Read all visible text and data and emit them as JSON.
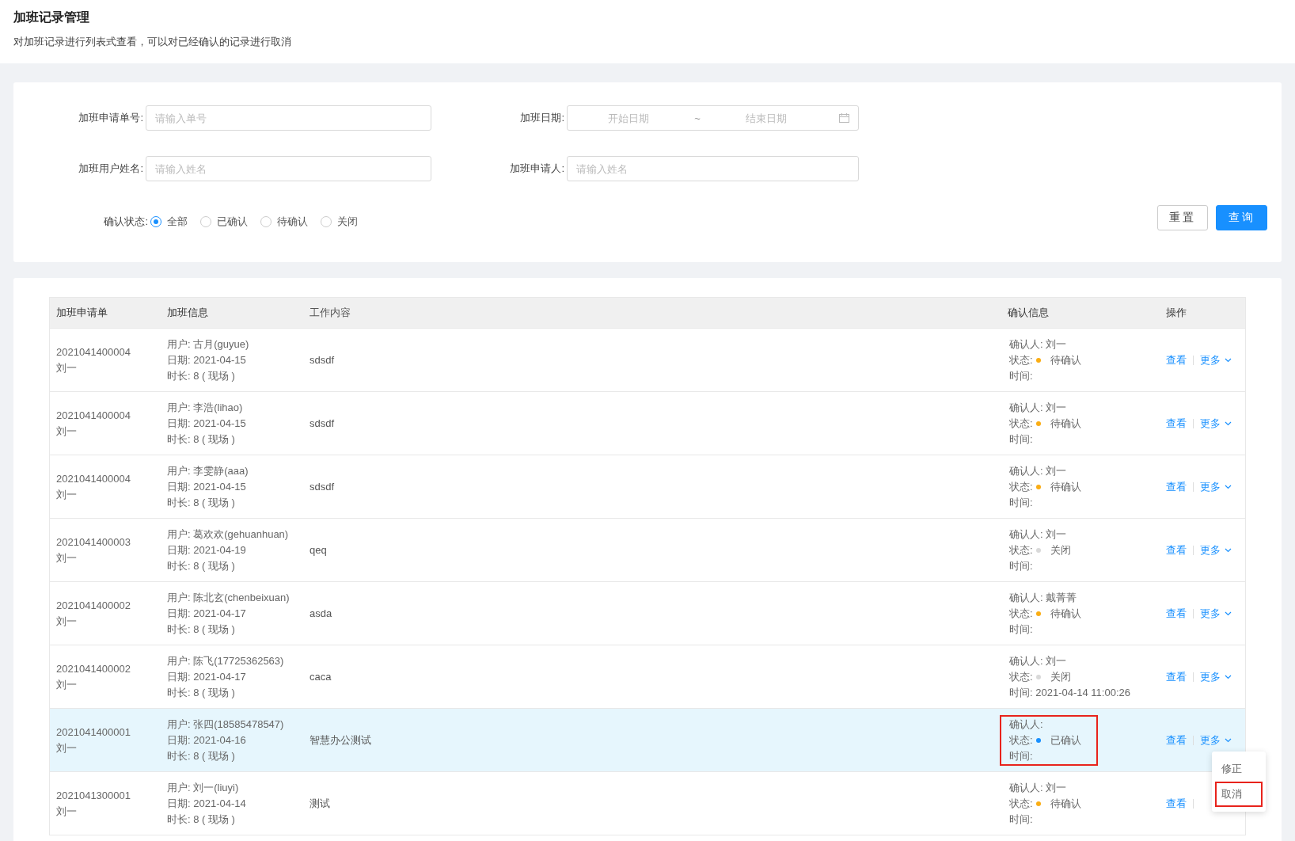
{
  "header": {
    "title": "加班记录管理",
    "subtitle": "对加班记录进行列表式查看，可以对已经确认的记录进行取消"
  },
  "filters": {
    "fields": [
      {
        "kind": "text",
        "label": "加班申请单号:",
        "placeholder": "请输入单号"
      },
      {
        "kind": "daterange",
        "label": "加班日期:",
        "start_placeholder": "开始日期",
        "separator": "~",
        "end_placeholder": "结束日期"
      },
      {
        "kind": "text",
        "label": "加班用户姓名:",
        "placeholder": "请输入姓名"
      },
      {
        "kind": "text",
        "label": "加班申请人:",
        "placeholder": "请输入姓名"
      }
    ],
    "status": {
      "label": "确认状态:",
      "options": [
        {
          "label": "全部",
          "selected": true
        },
        {
          "label": "已确认",
          "selected": false
        },
        {
          "label": "待确认",
          "selected": false
        },
        {
          "label": "关闭",
          "selected": false
        }
      ]
    },
    "buttons": [
      {
        "label": "重置",
        "kind": "default"
      },
      {
        "label": "查询",
        "kind": "primary"
      }
    ]
  },
  "table": {
    "columns": [
      "加班申请单",
      "加班信息",
      "工作内容",
      "确认信息",
      "操作"
    ],
    "rows": [
      {
        "order_no": "2021041400004",
        "applicant": "刘一",
        "user": "用户: 古月(guyue)",
        "date": "日期: 2021-04-15",
        "duration": "时长: 8 ( 现场 )",
        "content": "sdsdf",
        "confirmer": "确认人: 刘一",
        "status_label": "状态:",
        "status": "待确认",
        "color": "#faad14",
        "time": "时间:",
        "view": "查看",
        "more": "更多",
        "selected": false,
        "annotated": false
      },
      {
        "order_no": "2021041400004",
        "applicant": "刘一",
        "user": "用户: 李浩(lihao)",
        "date": "日期: 2021-04-15",
        "duration": "时长: 8 ( 现场 )",
        "content": "sdsdf",
        "confirmer": "确认人: 刘一",
        "status_label": "状态:",
        "status": "待确认",
        "color": "#faad14",
        "time": "时间:",
        "view": "查看",
        "more": "更多",
        "selected": false,
        "annotated": false
      },
      {
        "order_no": "2021041400004",
        "applicant": "刘一",
        "user": "用户: 李雯静(aaa)",
        "date": "日期: 2021-04-15",
        "duration": "时长: 8 ( 现场 )",
        "content": "sdsdf",
        "confirmer": "确认人: 刘一",
        "status_label": "状态:",
        "status": "待确认",
        "color": "#faad14",
        "time": "时间:",
        "view": "查看",
        "more": "更多",
        "selected": false,
        "annotated": false
      },
      {
        "order_no": "2021041400003",
        "applicant": "刘一",
        "user": "用户: 葛欢欢(gehuanhuan)",
        "date": "日期: 2021-04-19",
        "duration": "时长: 8 ( 现场 )",
        "content": "qeq",
        "confirmer": "确认人: 刘一",
        "status_label": "状态:",
        "status": "关闭",
        "color": "#d9d9d9",
        "time": "时间:",
        "view": "查看",
        "more": "更多",
        "selected": false,
        "annotated": false
      },
      {
        "order_no": "2021041400002",
        "applicant": "刘一",
        "user": "用户: 陈北玄(chenbeixuan)",
        "date": "日期: 2021-04-17",
        "duration": "时长: 8 ( 现场 )",
        "content": "asda",
        "confirmer": "确认人: 戴菁菁",
        "status_label": "状态:",
        "status": "待确认",
        "color": "#faad14",
        "time": "时间:",
        "view": "查看",
        "more": "更多",
        "selected": false,
        "annotated": false
      },
      {
        "order_no": "2021041400002",
        "applicant": "刘一",
        "user": "用户: 陈飞(17725362563)",
        "date": "日期: 2021-04-17",
        "duration": "时长: 8 ( 现场 )",
        "content": "caca",
        "confirmer": "确认人: 刘一",
        "status_label": "状态:",
        "status": "关闭",
        "color": "#d9d9d9",
        "time": "时间: 2021-04-14 11:00:26",
        "view": "查看",
        "more": "更多",
        "selected": false,
        "annotated": false
      },
      {
        "order_no": "2021041400001",
        "applicant": "刘一",
        "user": "用户: 张四(18585478547)",
        "date": "日期: 2021-04-16",
        "duration": "时长: 8 ( 现场 )",
        "content": "智慧办公测试",
        "confirmer": "确认人:",
        "status_label": "状态:",
        "status": "已确认",
        "color": "#1890ff",
        "time": "时间:",
        "view": "查看",
        "more": "更多",
        "selected": true,
        "annotated": true
      },
      {
        "order_no": "2021041300001",
        "applicant": "刘一",
        "user": "用户: 刘一(liuyi)",
        "date": "日期: 2021-04-14",
        "duration": "时长: 8 ( 现场 )",
        "content": "测试",
        "confirmer": "确认人: 刘一",
        "status_label": "状态:",
        "status": "待确认",
        "color": "#faad14",
        "time": "时间:",
        "view": "查看",
        "selected": false,
        "annotated": false
      }
    ]
  },
  "dropdown": {
    "items": [
      {
        "label": "修正",
        "annotated": false
      },
      {
        "label": "取消",
        "annotated": true
      }
    ]
  }
}
